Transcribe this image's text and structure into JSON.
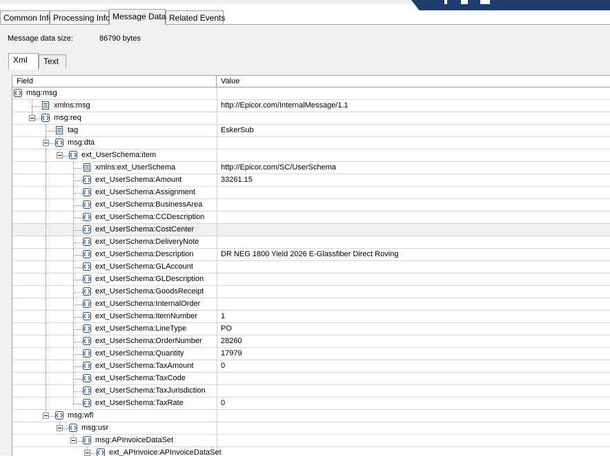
{
  "tabs": [
    "Common Info",
    "Processing Info",
    "Message Data",
    "Related Events"
  ],
  "active_tab": "Message Data",
  "message_size": {
    "label": "Message data size:",
    "value": "86790 bytes"
  },
  "subtabs": [
    "Xml",
    "Text"
  ],
  "grid": {
    "headers": [
      "Field",
      "Value"
    ],
    "rows": [
      {
        "field": "msg:msg",
        "value": "",
        "depth": 0,
        "type": "element",
        "expanded": true
      },
      {
        "field": "xmlns:msg",
        "value": "http://Epicor.com/InternalMessage/1.1",
        "depth": 1,
        "type": "attribute"
      },
      {
        "field": "msg:req",
        "value": "",
        "depth": 1,
        "type": "element",
        "expanded": true
      },
      {
        "field": "tag",
        "value": "EskerSub",
        "depth": 2,
        "type": "attribute"
      },
      {
        "field": "msg:dta",
        "value": "",
        "depth": 2,
        "type": "element",
        "expanded": true
      },
      {
        "field": "ext_UserSchema:item",
        "value": "",
        "depth": 3,
        "type": "element",
        "expanded": true
      },
      {
        "field": "xmlns:ext_UserSchema",
        "value": "http://Epicor.com/SC/UserSchema",
        "depth": 4,
        "type": "attribute"
      },
      {
        "field": "ext_UserSchema:Amount",
        "value": "33261.15",
        "depth": 4,
        "type": "element"
      },
      {
        "field": "ext_UserSchema:Assignment",
        "value": "",
        "depth": 4,
        "type": "element"
      },
      {
        "field": "ext_UserSchema:BusinessArea",
        "value": "",
        "depth": 4,
        "type": "element"
      },
      {
        "field": "ext_UserSchema:CCDescription",
        "value": "",
        "depth": 4,
        "type": "element"
      },
      {
        "field": "ext_UserSchema:CostCenter",
        "value": "",
        "depth": 4,
        "type": "element",
        "selected": true
      },
      {
        "field": "ext_UserSchema:DeliveryNote",
        "value": "",
        "depth": 4,
        "type": "element"
      },
      {
        "field": "ext_UserSchema:Description",
        "value": "DR NEG 1800  Yield 2026 E-Glassfiber Direct Roving",
        "depth": 4,
        "type": "element"
      },
      {
        "field": "ext_UserSchema:GLAccount",
        "value": "",
        "depth": 4,
        "type": "element"
      },
      {
        "field": "ext_UserSchema:GLDescription",
        "value": "",
        "depth": 4,
        "type": "element"
      },
      {
        "field": "ext_UserSchema:GoodsReceipt",
        "value": "",
        "depth": 4,
        "type": "element"
      },
      {
        "field": "ext_UserSchema:InternalOrder",
        "value": "",
        "depth": 4,
        "type": "element"
      },
      {
        "field": "ext_UserSchema:ItemNumber",
        "value": "1",
        "depth": 4,
        "type": "element"
      },
      {
        "field": "ext_UserSchema:LineType",
        "value": "PO",
        "depth": 4,
        "type": "element"
      },
      {
        "field": "ext_UserSchema:OrderNumber",
        "value": "28260",
        "depth": 4,
        "type": "element"
      },
      {
        "field": "ext_UserSchema:Quantity",
        "value": "17979",
        "depth": 4,
        "type": "element"
      },
      {
        "field": "ext_UserSchema:TaxAmount",
        "value": "0",
        "depth": 4,
        "type": "element"
      },
      {
        "field": "ext_UserSchema:TaxCode",
        "value": "",
        "depth": 4,
        "type": "element"
      },
      {
        "field": "ext_UserSchema:TaxJurisdiction",
        "value": "",
        "depth": 4,
        "type": "element"
      },
      {
        "field": "ext_UserSchema:TaxRate",
        "value": "0",
        "depth": 4,
        "type": "element"
      },
      {
        "field": "msg:wfl",
        "value": "",
        "depth": 2,
        "type": "element",
        "expanded": true
      },
      {
        "field": "msg:usr",
        "value": "",
        "depth": 3,
        "type": "element",
        "expanded": true
      },
      {
        "field": "msg:APInvoiceDataSet",
        "value": "",
        "depth": 4,
        "type": "element",
        "expanded": true
      },
      {
        "field": "ext_APInvoice:APInvoiceDataSet",
        "value": "",
        "depth": 5,
        "type": "element",
        "expanded": true
      }
    ]
  },
  "colors": {
    "icon_blue": "#2050b0",
    "grid_line": "#d8d8d8",
    "border": "#a0a0a0",
    "banner": "#1e3d6e"
  },
  "icons": {
    "element": "xml-element-icon",
    "attribute": "xml-attribute-icon",
    "expand": "tree-collapse-icon"
  }
}
